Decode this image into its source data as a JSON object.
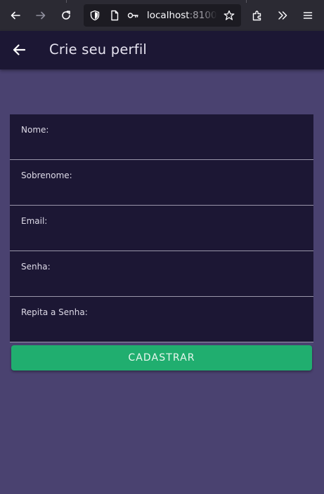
{
  "browser": {
    "url_host": "localhost",
    "url_rest": ":8100/",
    "icons": [
      "back-arrow-icon",
      "forward-arrow-icon",
      "reload-icon",
      "shield-icon",
      "page-icon",
      "key-icon",
      "bookmark-star-icon",
      "extensions-icon",
      "overflow-chevrons-icon",
      "hamburger-menu-icon"
    ]
  },
  "toolbar": {
    "title": "Crie seu perfil",
    "back_icon": "arrow-back-icon"
  },
  "form": {
    "fields": [
      {
        "label": "Nome:",
        "value": ""
      },
      {
        "label": "Sobrenome:",
        "value": ""
      },
      {
        "label": "Email:",
        "value": ""
      },
      {
        "label": "Senha:",
        "value": ""
      },
      {
        "label": "Repita a Senha:",
        "value": ""
      }
    ],
    "submit_label": "CADASTRAR"
  },
  "colors": {
    "page_background": "#4a4270",
    "toolbar_background": "#1c1734",
    "card_background": "#1c1734",
    "accent_success": "#20ae6f"
  }
}
